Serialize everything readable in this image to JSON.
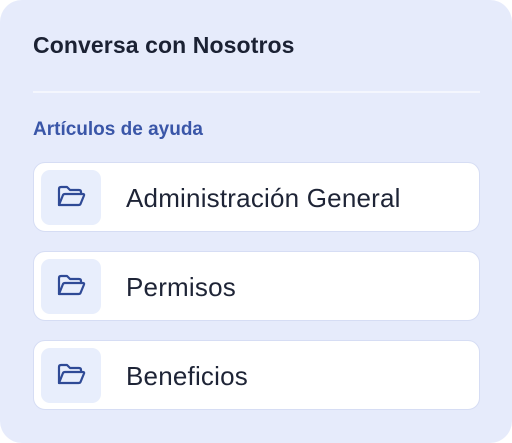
{
  "card": {
    "title": "Conversa con Nosotros",
    "section_label": "Artículos de ayuda",
    "items": [
      {
        "label": "Administración General",
        "icon": "folder-open-icon"
      },
      {
        "label": "Permisos",
        "icon": "folder-open-icon"
      },
      {
        "label": "Beneficios",
        "icon": "folder-open-icon"
      }
    ]
  },
  "colors": {
    "card_background": "#e6ebfb",
    "title_text": "#1b2133",
    "section_label_text": "#3a56a8",
    "icon_stroke": "#2f4a96",
    "item_background": "#ffffff",
    "icon_background": "#e8eefc"
  }
}
